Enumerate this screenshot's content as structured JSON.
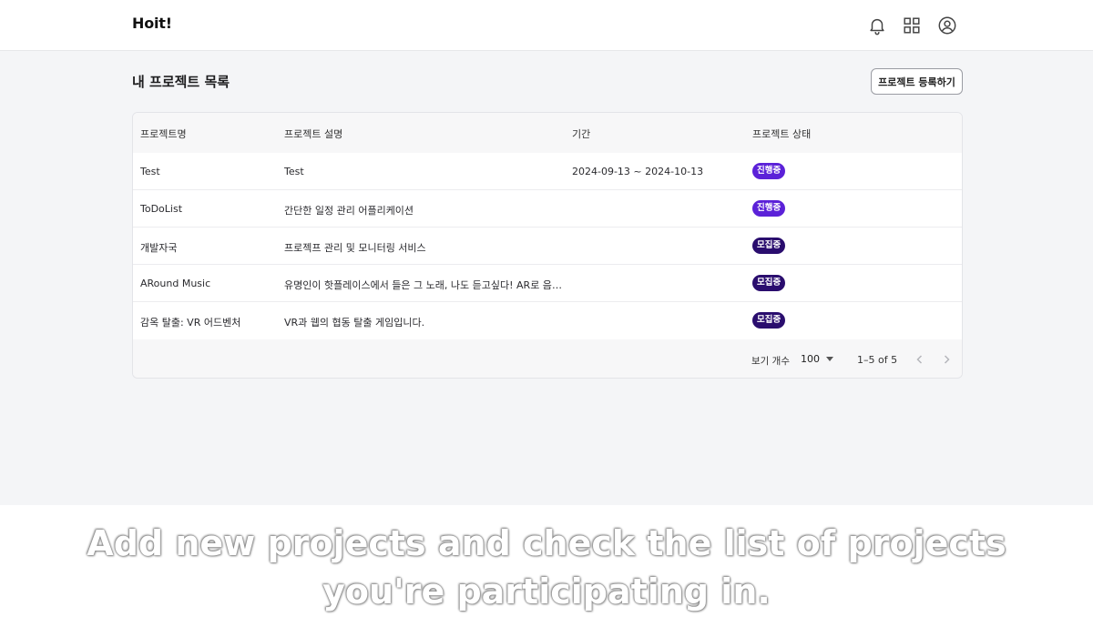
{
  "header": {
    "logo": "Hoit!",
    "icons": [
      "bell-icon",
      "grid-icon",
      "user-icon"
    ]
  },
  "page": {
    "title": "내 프로젝트 목록",
    "register_button": "프로젝트 등록하기"
  },
  "table": {
    "columns": [
      "프로젝트명",
      "프로젝트 설명",
      "기간",
      "프로젝트 상태"
    ],
    "rows": [
      {
        "name": "Test",
        "description": "Test",
        "period": "2024-09-13 ~ 2024-10-13",
        "status": "진행중",
        "status_color": "#5b21d8"
      },
      {
        "name": "ToDoList",
        "description": "간단한 일정 관리 어플리케이션",
        "period": "",
        "status": "진행중",
        "status_color": "#5b21d8"
      },
      {
        "name": "개발자국",
        "description": "프로젝프 관리 및 모니터링 서비스",
        "period": "",
        "status": "모집중",
        "status_color": "#2a0d6e"
      },
      {
        "name": "ARound Music",
        "description": "유명인이 핫플레이스에서 들은 그 노래, 나도 듣고싶다! AR로 음악을...",
        "period": "",
        "status": "모집중",
        "status_color": "#2a0d6e"
      },
      {
        "name": "감옥 탈출: VR 어드벤처",
        "description": "VR과 웹의 협동 탈출 게임입니다.",
        "period": "",
        "status": "모집중",
        "status_color": "#2a0d6e"
      }
    ],
    "footer": {
      "per_page_label": "보기 개수",
      "per_page_value": "100",
      "range_text": "1–5 of 5"
    }
  },
  "caption": {
    "line1": "Add new projects and check the list of projects",
    "line2": "you're participating in."
  }
}
